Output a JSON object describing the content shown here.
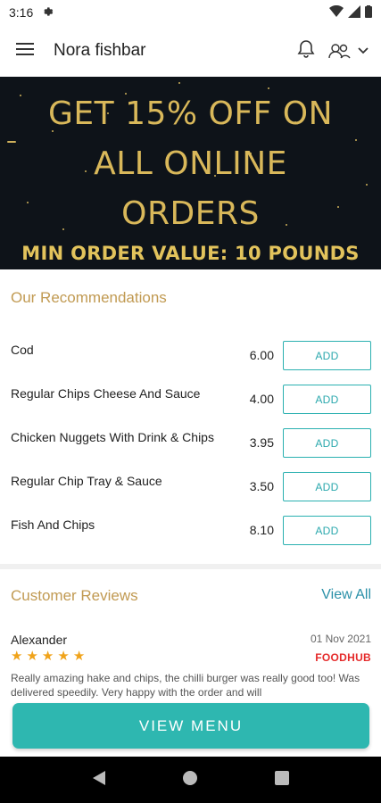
{
  "status_bar": {
    "time": "3:16"
  },
  "app_bar": {
    "title": "Nora fishbar"
  },
  "banner": {
    "line1": "GET 15% OFF ON",
    "line2": "ALL ONLINE",
    "line3": "ORDERS",
    "subline": "MIN ORDER VALUE: 10 POUNDS"
  },
  "recommendations": {
    "title": "Our Recommendations",
    "items": [
      {
        "name": "Cod",
        "price": "6.00",
        "button": "ADD"
      },
      {
        "name": "Regular Chips Cheese And Sauce",
        "price": "4.00",
        "button": "ADD"
      },
      {
        "name": "Chicken Nuggets With Drink & Chips",
        "price": "3.95",
        "button": "ADD"
      },
      {
        "name": "Regular Chip Tray & Sauce",
        "price": "3.50",
        "button": "ADD"
      },
      {
        "name": "Fish And Chips",
        "price": "8.10",
        "button": "ADD"
      }
    ]
  },
  "reviews": {
    "title": "Customer Reviews",
    "view_all": "View All",
    "items": [
      {
        "name": "Alexander",
        "date": "01 Nov 2021",
        "rating": 5,
        "source": "FOODHUB",
        "text": "Really amazing hake and chips, the chilli burger was really good too! Was delivered speedily. Very happy with the order and will"
      }
    ]
  },
  "cta": {
    "label": "VIEW MENU"
  },
  "colors": {
    "accent": "#2eb7b0",
    "gold": "#c19a52",
    "star": "#f0a31a",
    "brand_red": "#e52b2b"
  }
}
